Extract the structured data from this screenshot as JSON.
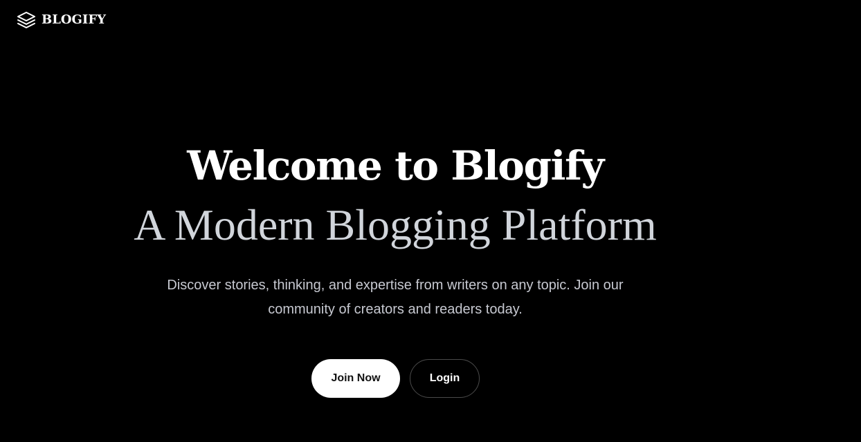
{
  "header": {
    "logo_icon": "layers-icon",
    "brand": "BLOGIFY"
  },
  "hero": {
    "title": "Welcome to Blogify",
    "subtitle": "A Modern Blogging Platform",
    "description": "Discover stories, thinking, and expertise from writers on any topic. Join our community of creators and readers today."
  },
  "actions": {
    "join_label": "Join Now",
    "login_label": "Login"
  },
  "colors": {
    "background": "#000000",
    "title": "#ffffff",
    "subtitle": "#d1d5db",
    "description": "#c7c9d1",
    "primary_button_bg": "#ffffff",
    "primary_button_text": "#111111",
    "secondary_button_border": "#4b4b4b"
  }
}
